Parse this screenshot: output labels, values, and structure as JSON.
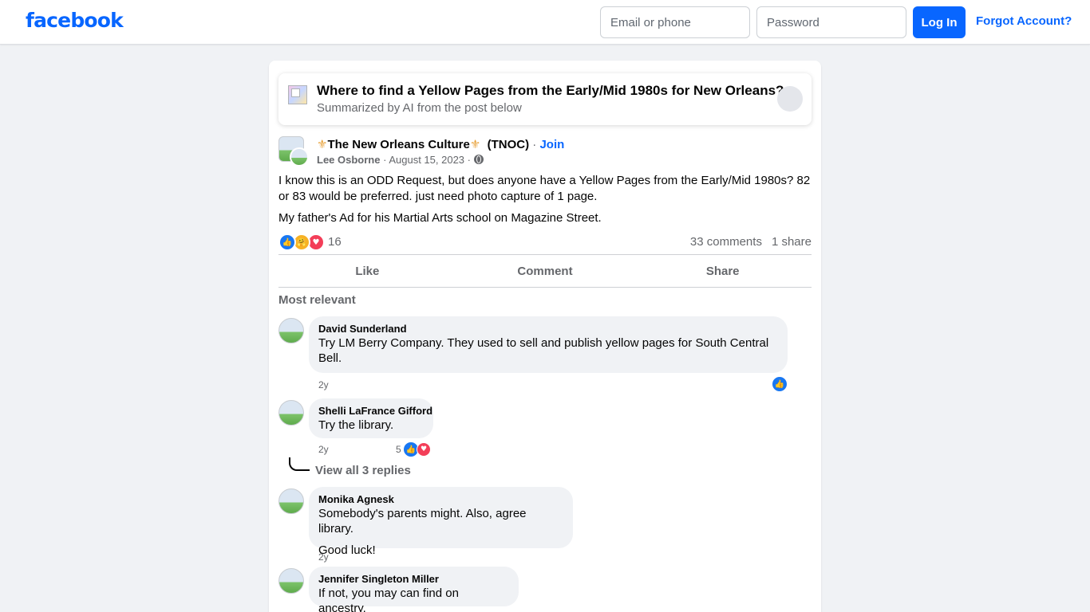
{
  "header": {
    "logo": "facebook",
    "email_placeholder": "Email or phone",
    "password_placeholder": "Password",
    "login_label": "Log In",
    "forgot_label": "Forgot Account?"
  },
  "summary": {
    "title": "Where to find a Yellow Pages from the Early/Mid 1980s for New Orleans?",
    "subtitle": "Summarized by AI from the post below"
  },
  "post": {
    "group_name": "The New Orleans Culture",
    "group_suffix": "(TNOC)",
    "fleur_symbol": "⚜",
    "separator": "·",
    "join_label": "Join",
    "author": "Lee Osborne",
    "date": "August 15, 2023",
    "body": "I know this is an ODD Request, but does anyone have a Yellow Pages from the Early/Mid 1980s? 82 or 83 would be preferred. just need photo capture of 1 page.",
    "body2": "My father's Ad for his Martial Arts school on Magazine Street.",
    "reaction_count": "16",
    "comments_count": "33 comments",
    "shares_count": "1 share",
    "actions": {
      "like": "Like",
      "comment": "Comment",
      "share": "Share"
    },
    "sort_label": "Most relevant"
  },
  "comments": [
    {
      "name": "David Sunderland",
      "text": "Try LM Berry Company. They used to sell and publish yellow pages for South Central Bell.",
      "time": "2y"
    },
    {
      "name": "Shelli LaFrance Gifford",
      "text": "Try the library.",
      "time": "2y",
      "reaction_count": "5",
      "view_replies": "View all 3 replies"
    },
    {
      "name": "Monika Agnesk",
      "text": "Somebody's parents might. Also, agree library.",
      "text2": "Good luck!",
      "time": "2y"
    },
    {
      "name": "Jennifer Singleton Miller",
      "text": "If not, you may can find on ancestry."
    }
  ],
  "icons": {
    "like": "👍",
    "care": "🤗",
    "love": "♥"
  },
  "colors": {
    "brand": "#0866ff",
    "like_blue": "#1877f2",
    "love_red": "#f33e58",
    "care_yellow": "#f7b125",
    "page_bg": "#f0f2f5"
  }
}
